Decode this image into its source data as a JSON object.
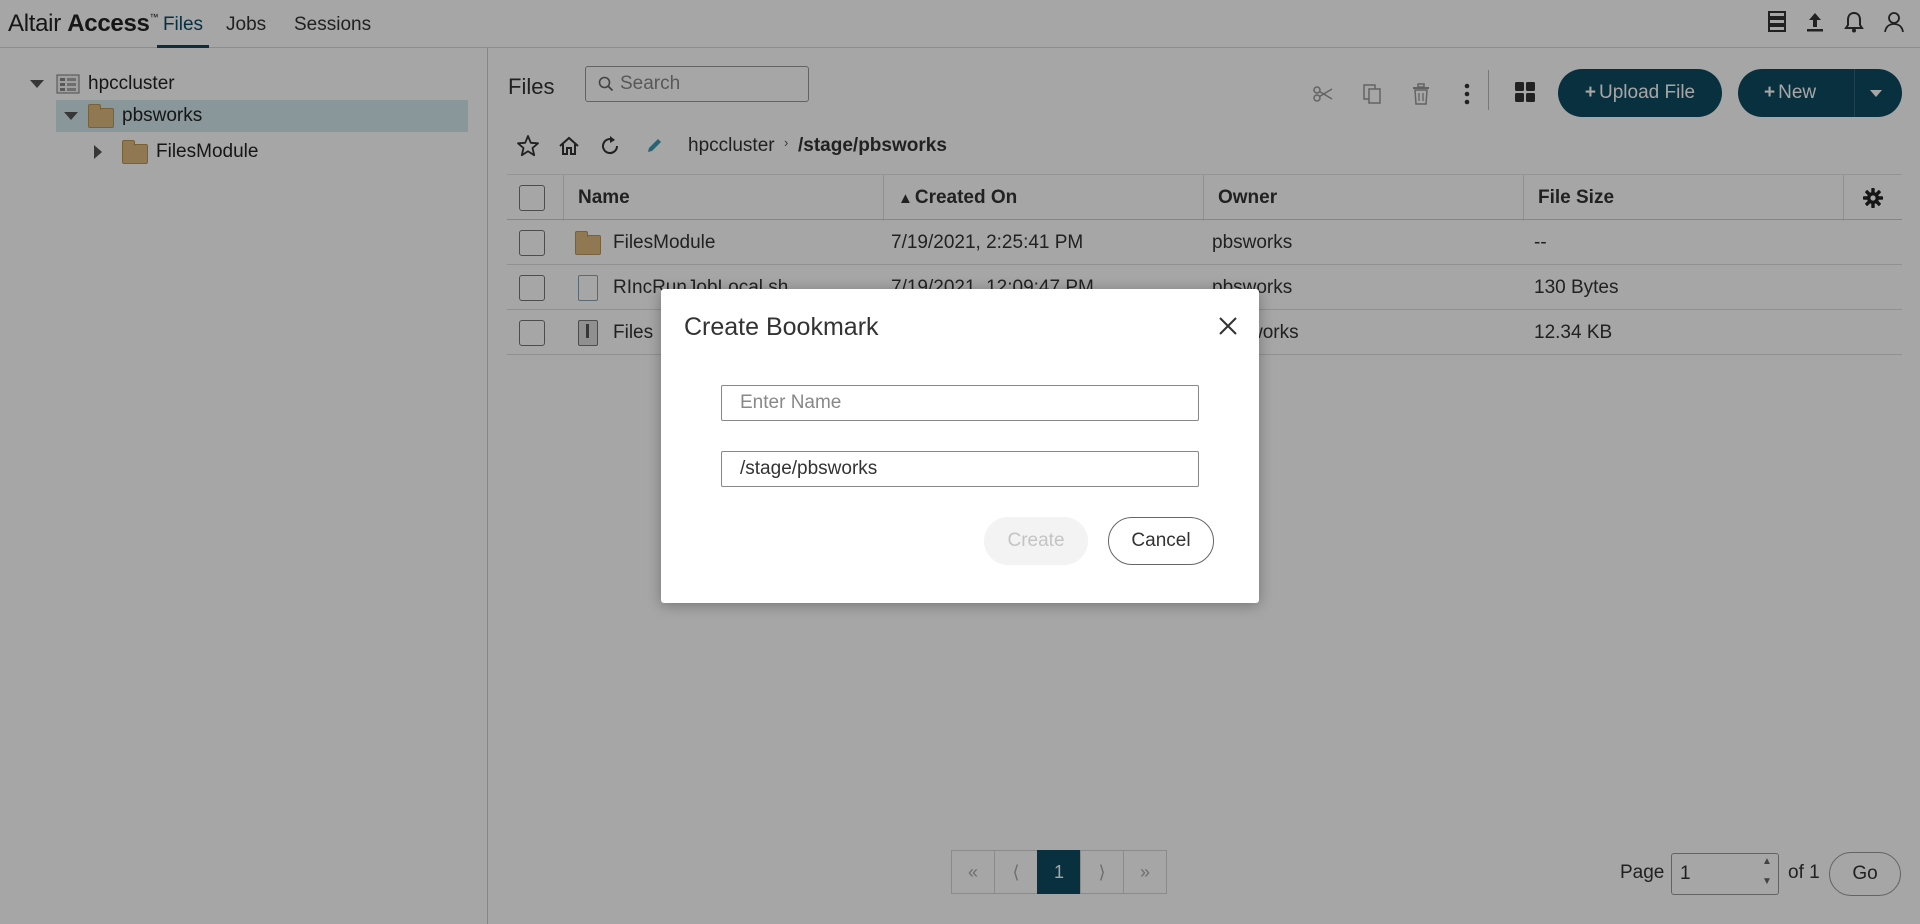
{
  "app": {
    "brand_light": "Altair",
    "brand_bold": "Access",
    "brand_tm": "™"
  },
  "nav": {
    "tabs": [
      {
        "label": "Files"
      },
      {
        "label": "Jobs"
      },
      {
        "label": "Sessions"
      }
    ]
  },
  "header_icons": [
    "server-icon",
    "upload-icon",
    "bell-icon",
    "user-icon"
  ],
  "tree": {
    "items": [
      {
        "label": "hpccluster"
      },
      {
        "label": "pbsworks"
      },
      {
        "label": "FilesModule"
      }
    ]
  },
  "main": {
    "title": "Files",
    "search_placeholder": "Search",
    "upload_label": "Upload File",
    "new_label": "New",
    "breadcrumb": {
      "root": "hpccluster",
      "path": "/stage/pbsworks"
    }
  },
  "table": {
    "columns": [
      "Name",
      "Created On",
      "Owner",
      "File Size"
    ],
    "sort_indicator": "▲",
    "rows": [
      {
        "name": "FilesModule",
        "created": "7/19/2021, 2:25:41 PM",
        "owner": "pbsworks",
        "size": "--"
      },
      {
        "name": "RIncRunJobLocal.sh",
        "created": "7/19/2021, 12:09:47 PM",
        "owner": "pbsworks",
        "size": "130 Bytes"
      },
      {
        "name": "Files",
        "created": "",
        "owner": "works",
        "size": "12.34 KB"
      }
    ]
  },
  "pagination": {
    "first": "«",
    "prev": "⟨",
    "current": "1",
    "next": "⟩",
    "last": "»",
    "page_label": "Page",
    "page_value": "1",
    "of_label": "of 1",
    "go_label": "Go"
  },
  "modal": {
    "title": "Create Bookmark",
    "name_placeholder": "Enter Name",
    "path_value": "/stage/pbsworks",
    "create_label": "Create",
    "cancel_label": "Cancel"
  },
  "colors": {
    "primary": "#0e4a61",
    "selected_tree": "#d3e9ee",
    "folder": "#dcb97e"
  }
}
